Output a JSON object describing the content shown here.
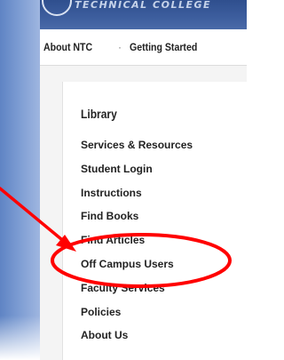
{
  "banner": {
    "text": "TECHNICAL COLLEGE"
  },
  "topnav": {
    "items": [
      "About NTC",
      "Getting Started"
    ],
    "separator": "·"
  },
  "sidebar": {
    "title": "Library",
    "links": [
      "Services & Resources",
      "Student Login",
      "Instructions",
      "Find Books",
      "Find Articles",
      "Off Campus Users",
      "Faculty Services",
      "Policies",
      "About Us"
    ]
  },
  "annotation": {
    "color": "#ff0000",
    "highlighted_link": "Off Campus Users"
  }
}
